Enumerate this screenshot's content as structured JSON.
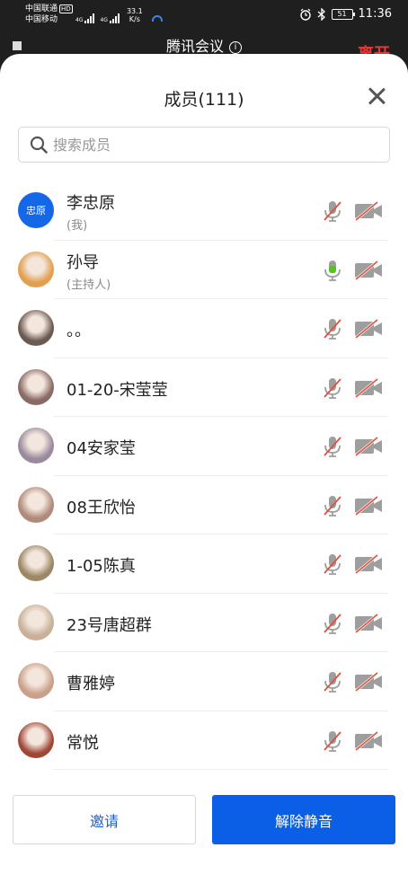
{
  "status_bar": {
    "carrier1": "中国联通",
    "carrier1_badge": "HD",
    "carrier2": "中国移动",
    "net_type_1": "4G",
    "net_type_2": "4G",
    "net_speed": "33.1",
    "net_speed_unit": "K/s",
    "battery": "51",
    "time": "11:36"
  },
  "meeting": {
    "title": "腾讯会议",
    "leave_label": "离开"
  },
  "sheet": {
    "title": "成员(111)"
  },
  "search": {
    "placeholder": "搜索成员"
  },
  "members": [
    {
      "name": "李忠原",
      "role": "(我)",
      "avatar_text": "忠原",
      "mic": "muted",
      "camera": "off"
    },
    {
      "name": "孙导",
      "role": "(主持人)",
      "avatar_color": "#e0a050",
      "mic": "on",
      "camera": "off"
    },
    {
      "name": "。。",
      "avatar_color": "#6b5a52",
      "mic": "muted",
      "camera": "off"
    },
    {
      "name": "01-20-宋莹莹",
      "avatar_color": "#8a6a66",
      "mic": "muted",
      "camera": "off"
    },
    {
      "name": "04安家莹",
      "avatar_color": "#9a8a9e",
      "mic": "muted",
      "camera": "off"
    },
    {
      "name": "08王欣怡",
      "avatar_color": "#b08a7a",
      "mic": "muted",
      "camera": "off"
    },
    {
      "name": "1-05陈真",
      "avatar_color": "#9c8766",
      "mic": "muted",
      "camera": "off"
    },
    {
      "name": "23号唐超群",
      "avatar_color": "#c8b09a",
      "mic": "muted",
      "camera": "off"
    },
    {
      "name": "曹雅婷",
      "avatar_color": "#caa08a",
      "mic": "muted",
      "camera": "off"
    },
    {
      "name": "常悦",
      "avatar_color": "#a04838",
      "mic": "muted",
      "camera": "off"
    }
  ],
  "buttons": {
    "invite": "邀请",
    "unmute": "解除静音"
  },
  "colors": {
    "accent": "#0a5fe6",
    "muted_slash": "#e0503c",
    "mic_active": "#52c41a"
  }
}
